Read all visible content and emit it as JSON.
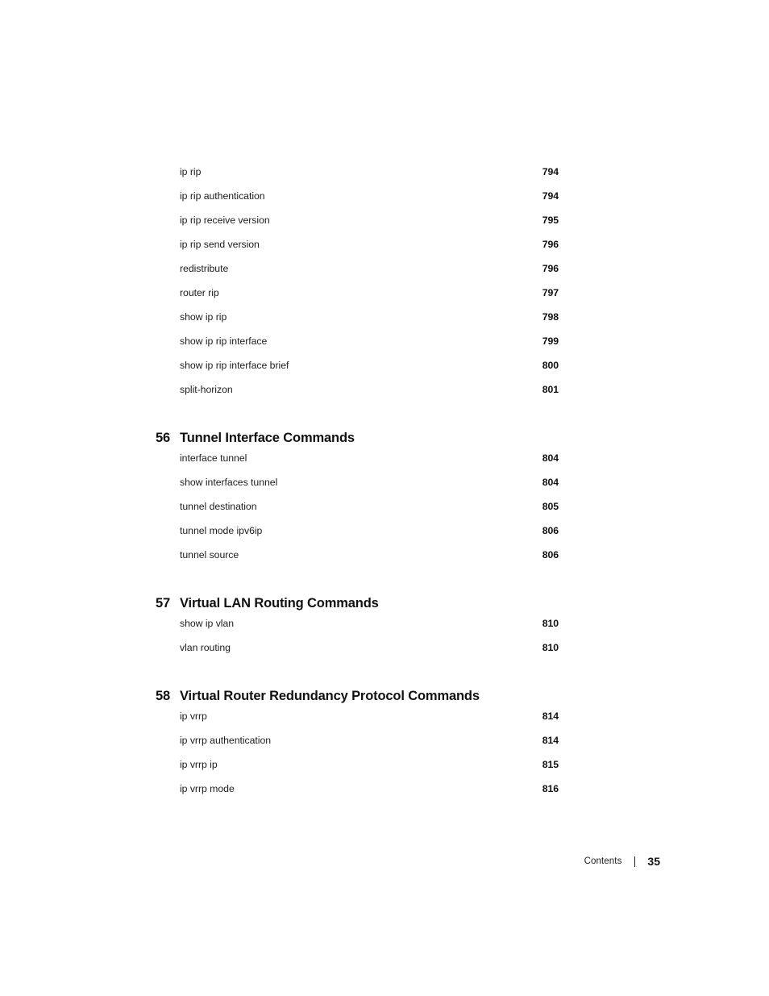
{
  "document": {
    "type": "table-of-contents",
    "footer": {
      "label": "Contents",
      "separator": "|",
      "page_number": "35"
    }
  },
  "toc": {
    "leading_entries": [
      {
        "label": "ip rip",
        "page": "794"
      },
      {
        "label": "ip rip authentication",
        "page": "794"
      },
      {
        "label": "ip rip receive version",
        "page": "795"
      },
      {
        "label": "ip rip send version",
        "page": "796"
      },
      {
        "label": "redistribute",
        "page": "796"
      },
      {
        "label": "router rip",
        "page": "797"
      },
      {
        "label": "show ip rip",
        "page": "798"
      },
      {
        "label": "show ip rip interface",
        "page": "799"
      },
      {
        "label": "show ip rip interface brief",
        "page": "800"
      },
      {
        "label": "split-horizon",
        "page": "801"
      }
    ],
    "chapters": [
      {
        "number": "56",
        "title": "Tunnel Interface Commands",
        "entries": [
          {
            "label": "interface tunnel",
            "page": "804"
          },
          {
            "label": "show interfaces tunnel",
            "page": "804"
          },
          {
            "label": "tunnel destination",
            "page": "805"
          },
          {
            "label": "tunnel mode ipv6ip",
            "page": "806"
          },
          {
            "label": "tunnel source",
            "page": "806"
          }
        ]
      },
      {
        "number": "57",
        "title": "Virtual LAN Routing Commands",
        "entries": [
          {
            "label": "show ip vlan",
            "page": "810"
          },
          {
            "label": "vlan routing",
            "page": "810"
          }
        ]
      },
      {
        "number": "58",
        "title": "Virtual Router Redundancy Protocol Commands",
        "entries": [
          {
            "label": "ip vrrp",
            "page": "814"
          },
          {
            "label": "ip vrrp authentication",
            "page": "814"
          },
          {
            "label": "ip vrrp ip",
            "page": "815"
          },
          {
            "label": "ip vrrp mode",
            "page": "816"
          }
        ]
      }
    ]
  }
}
